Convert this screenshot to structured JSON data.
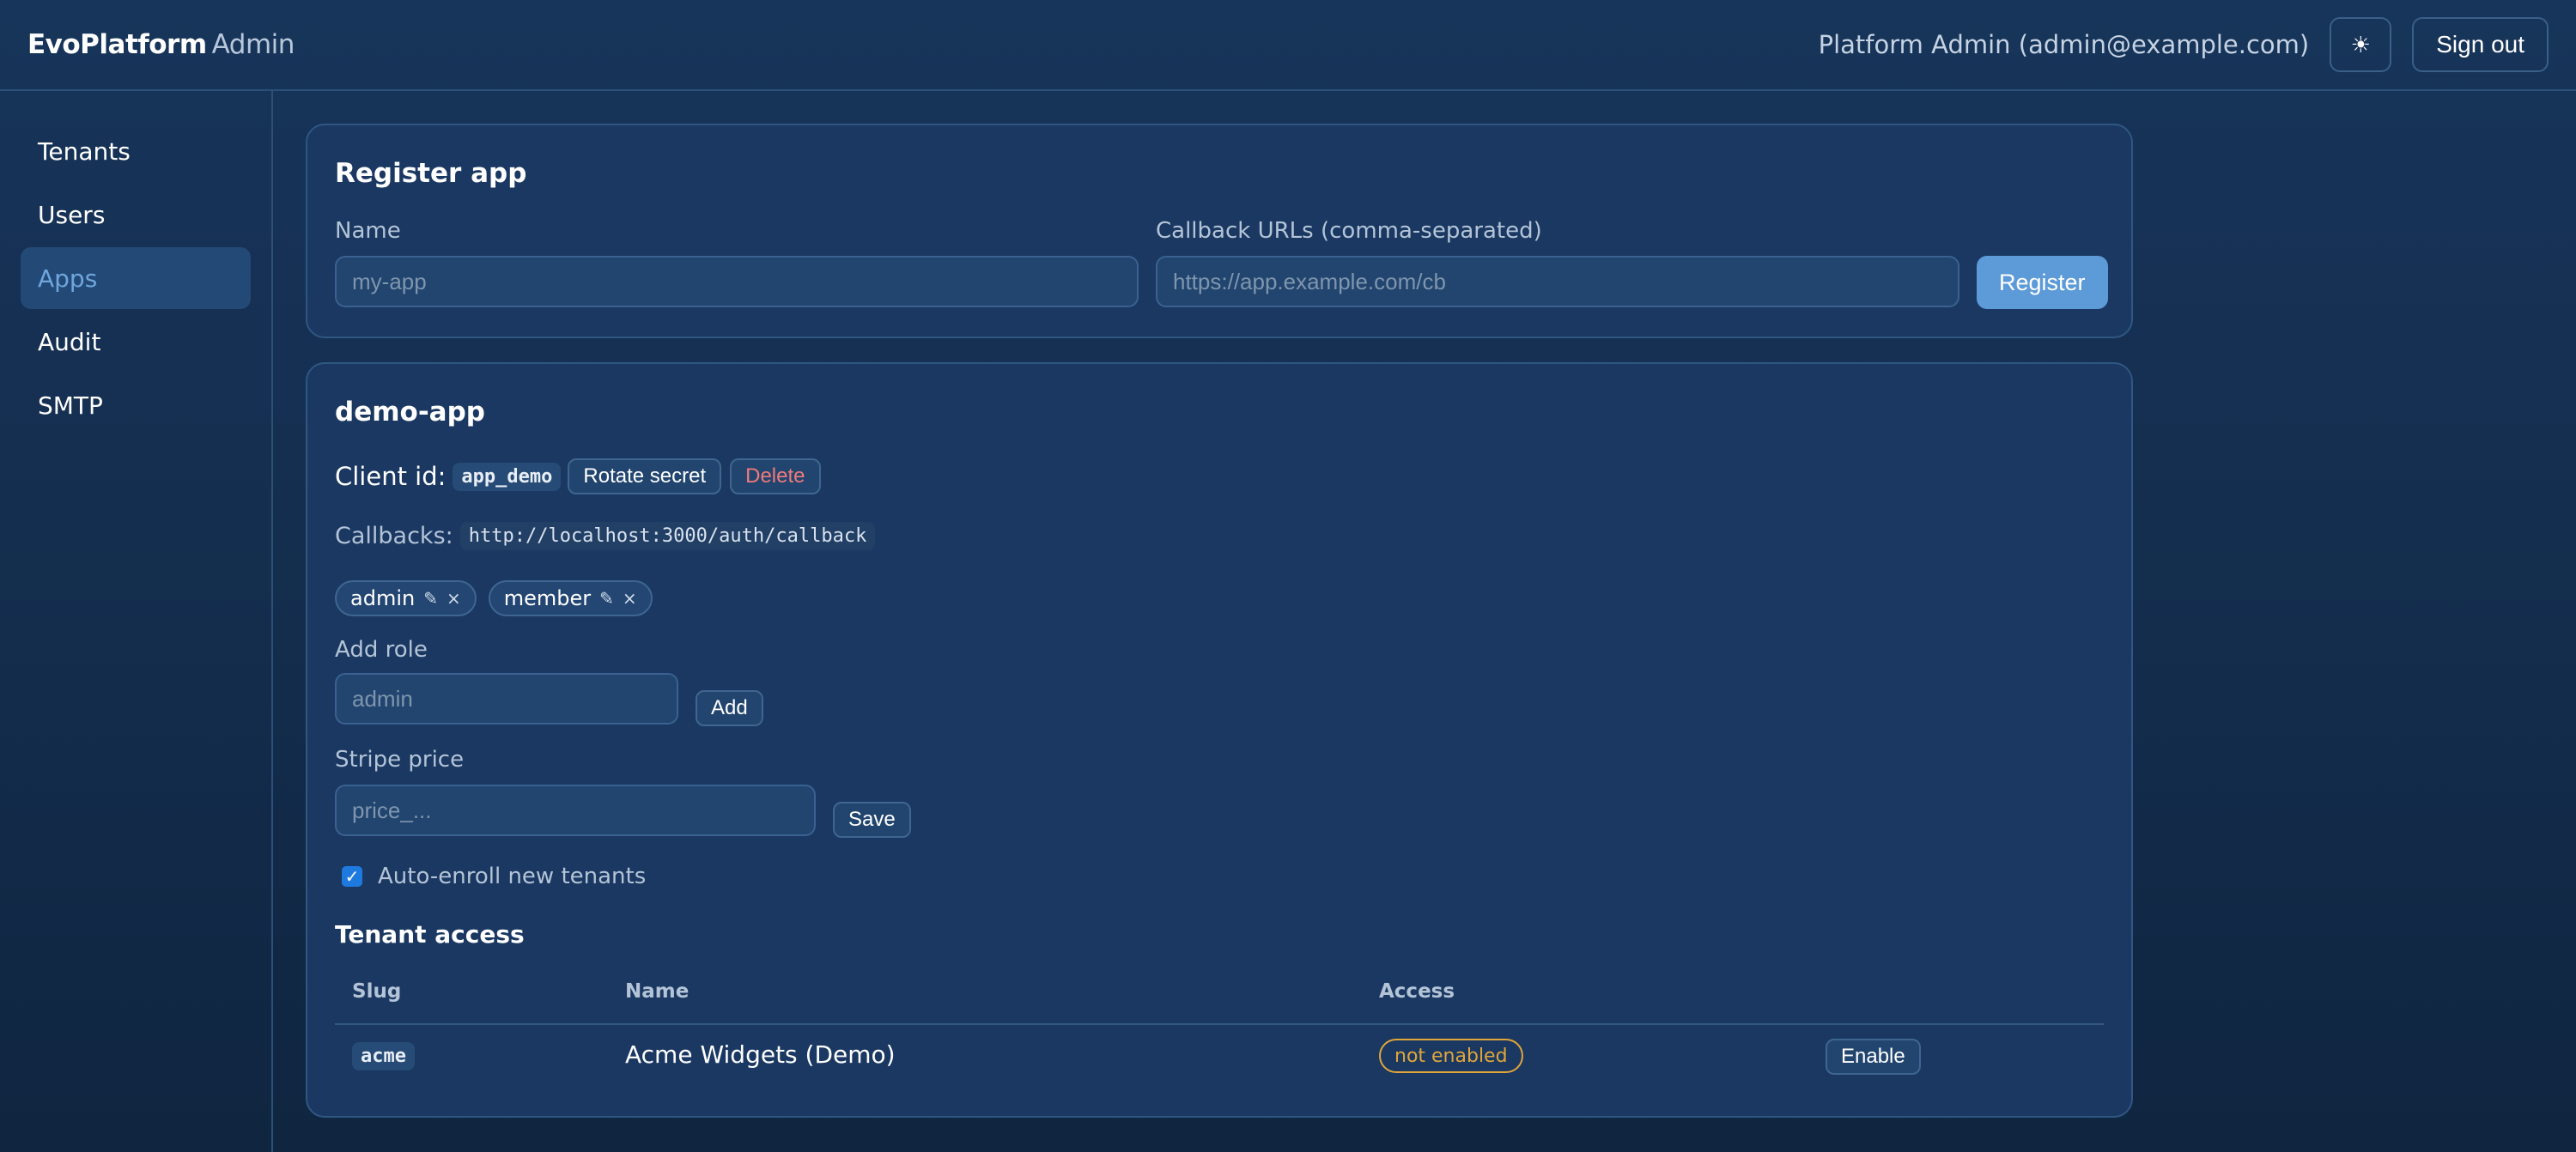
{
  "header": {
    "brand": "EvoPlatform",
    "brand_sub": "Admin",
    "user_label": "Platform Admin (admin@example.com)",
    "theme_icon": "☀",
    "signout_label": "Sign out"
  },
  "sidebar": {
    "items": [
      {
        "label": "Tenants"
      },
      {
        "label": "Users"
      },
      {
        "label": "Apps"
      },
      {
        "label": "Audit"
      },
      {
        "label": "SMTP"
      }
    ],
    "active": "Apps"
  },
  "register": {
    "title": "Register app",
    "name_label": "Name",
    "name_placeholder": "my-app",
    "callback_label": "Callback URLs (comma-separated)",
    "callback_placeholder": "https://app.example.com/cb",
    "register_label": "Register"
  },
  "app": {
    "title": "demo-app",
    "client_id_label": "Client id:",
    "client_id": "app_demo",
    "rotate_label": "Rotate secret",
    "delete_label": "Delete",
    "callbacks_label": "Callbacks:",
    "callback_url": "http://localhost:3000/auth/callback",
    "roles": [
      {
        "name": "admin",
        "edit_icon": "✎",
        "remove_icon": "×"
      },
      {
        "name": "member",
        "edit_icon": "✎",
        "remove_icon": "×"
      }
    ],
    "add_role_label": "Add role",
    "add_role_placeholder": "admin",
    "add_label": "Add",
    "stripe_label": "Stripe price",
    "stripe_placeholder": "price_...",
    "save_label": "Save",
    "auto_enroll_label": "Auto-enroll new tenants",
    "auto_enroll_checked": true,
    "tenant_access_title": "Tenant access",
    "table": {
      "headers": [
        "Slug",
        "Name",
        "Access",
        ""
      ],
      "rows": [
        {
          "slug": "acme",
          "name": "Acme Widgets (Demo)",
          "access": "not enabled",
          "action": "Enable"
        }
      ]
    }
  },
  "colors": {
    "accent": "#5c9ad8",
    "danger": "#f07a7a",
    "warning": "#e0a63a"
  }
}
